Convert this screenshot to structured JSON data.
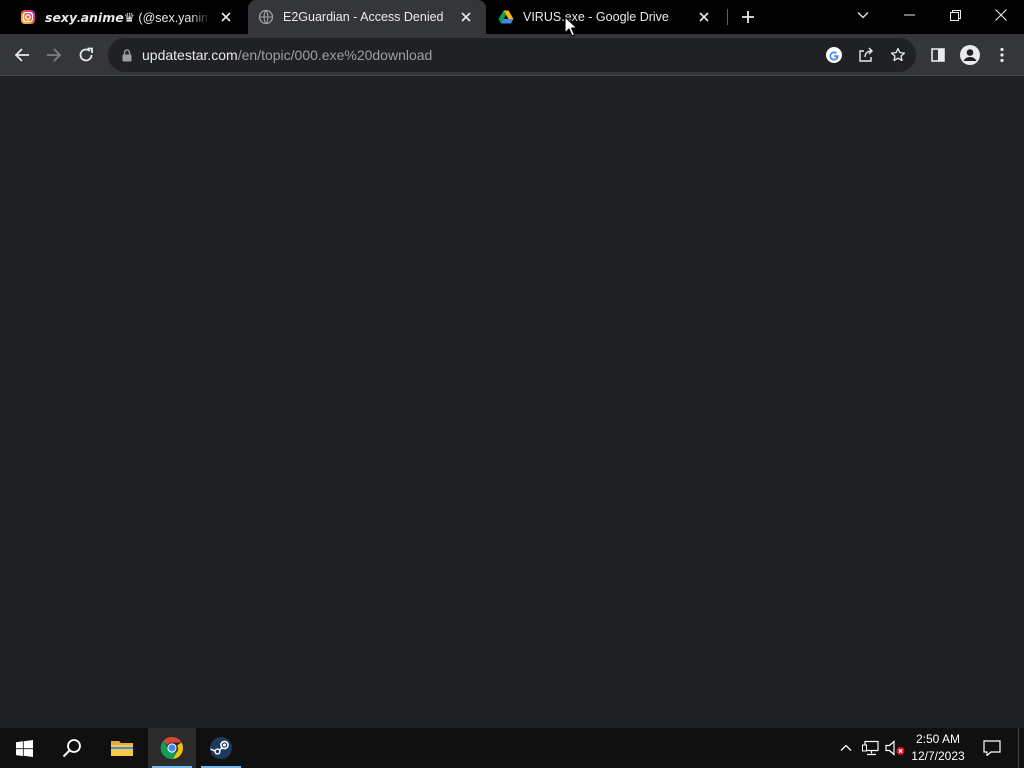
{
  "tabs": [
    {
      "title_styled": "𝙨𝙚𝙭𝙮.𝙖𝙣𝙞𝙢𝙚♛",
      "title_rest": " (@sex.yanimee) •",
      "favicon": "instagram-icon",
      "active": false
    },
    {
      "title": "E2Guardian - Access Denied",
      "favicon": "globe-icon",
      "active": true
    },
    {
      "title": "VIRUS.exe - Google Drive",
      "favicon": "google-drive-icon",
      "active": false
    }
  ],
  "omnibox": {
    "host": "updatestar.com",
    "path": "/en/topic/000.exe%20download"
  },
  "taskbar": {
    "time": "2:50 AM",
    "date": "12/7/2023"
  },
  "colors": {
    "tabstrip": "#000000",
    "toolbar": "#35363a",
    "content": "#202124",
    "taskbar": "#101010",
    "accent": "#76b9ed"
  }
}
